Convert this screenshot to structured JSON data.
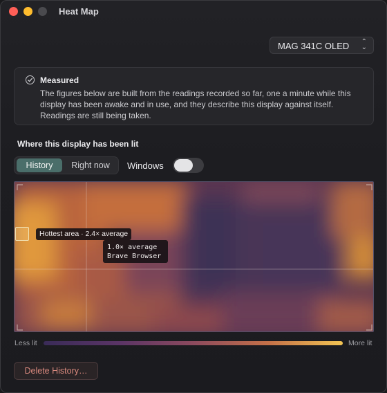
{
  "window": {
    "title": "Heat Map"
  },
  "display_select": {
    "value": "MAG 341C OLED"
  },
  "notice": {
    "title": "Measured",
    "body": "The figures below are built from the readings recorded so far, one a minute while this display has been awake and in use, and they describe this display against itself. Readings are still being taken."
  },
  "section": {
    "heading": "Where this display has been lit"
  },
  "tabs": [
    {
      "label": "History",
      "active": true
    },
    {
      "label": "Right now",
      "active": false
    }
  ],
  "windows_toggle": {
    "label": "Windows",
    "on": false
  },
  "heatmap": {
    "hottest_label": "Hottest area · 2.4× average",
    "cursor_line1": "1.0× average",
    "cursor_line2": "Brave Browser"
  },
  "legend": {
    "less": "Less lit",
    "more": "More lit"
  },
  "delete_button": {
    "label": "Delete History…"
  },
  "colors": {
    "accent_tab": "#4a6e6a",
    "destructive_text": "#d9897e",
    "heat_low": "#3a2b58",
    "heat_high": "#f2c453"
  }
}
